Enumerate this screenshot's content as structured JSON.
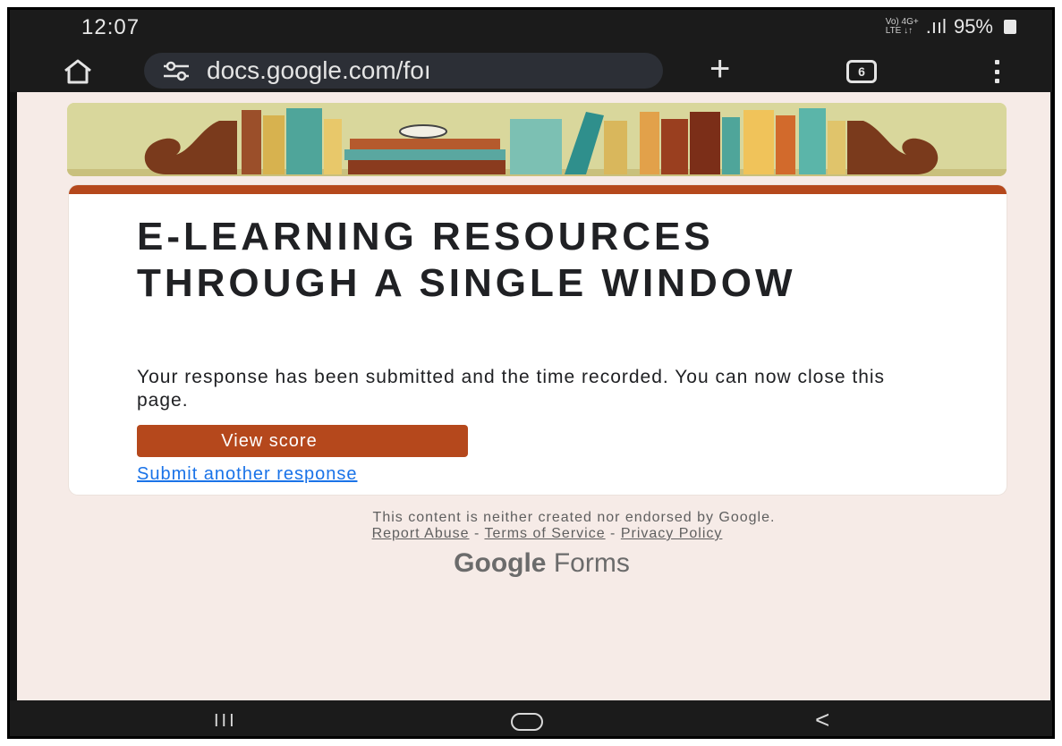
{
  "status_bar": {
    "time": "12:07",
    "network_top": "Vo) 4G+",
    "network_bottom": "LTE ↓↑",
    "signal": ".ııl",
    "battery": "95%"
  },
  "browser": {
    "url": "docs.google.com/foı",
    "tab_count": "6"
  },
  "form": {
    "title": "E-LEARNING RESOURCES THROUGH A SINGLE WINDOW",
    "confirmation": "Your response has been submitted and the time recorded. You can now close this page.",
    "view_score_label": "View score",
    "submit_another_label": "Submit another response",
    "accent_color": "#b5481c"
  },
  "footer": {
    "disclaimer": "This content is neither created nor endorsed by Google.",
    "report_abuse": "Report Abuse",
    "terms": "Terms of Service",
    "privacy": "Privacy Policy",
    "separator": " - ",
    "brand_google": "Google",
    "brand_forms": "Forms"
  },
  "nav": {
    "recent_apps": "III",
    "back": "<"
  },
  "icons": [
    "home-icon",
    "tune-icon",
    "plus-icon",
    "tabs-icon",
    "more-vert-icon",
    "recent-apps-icon",
    "nav-home-icon",
    "back-icon"
  ]
}
